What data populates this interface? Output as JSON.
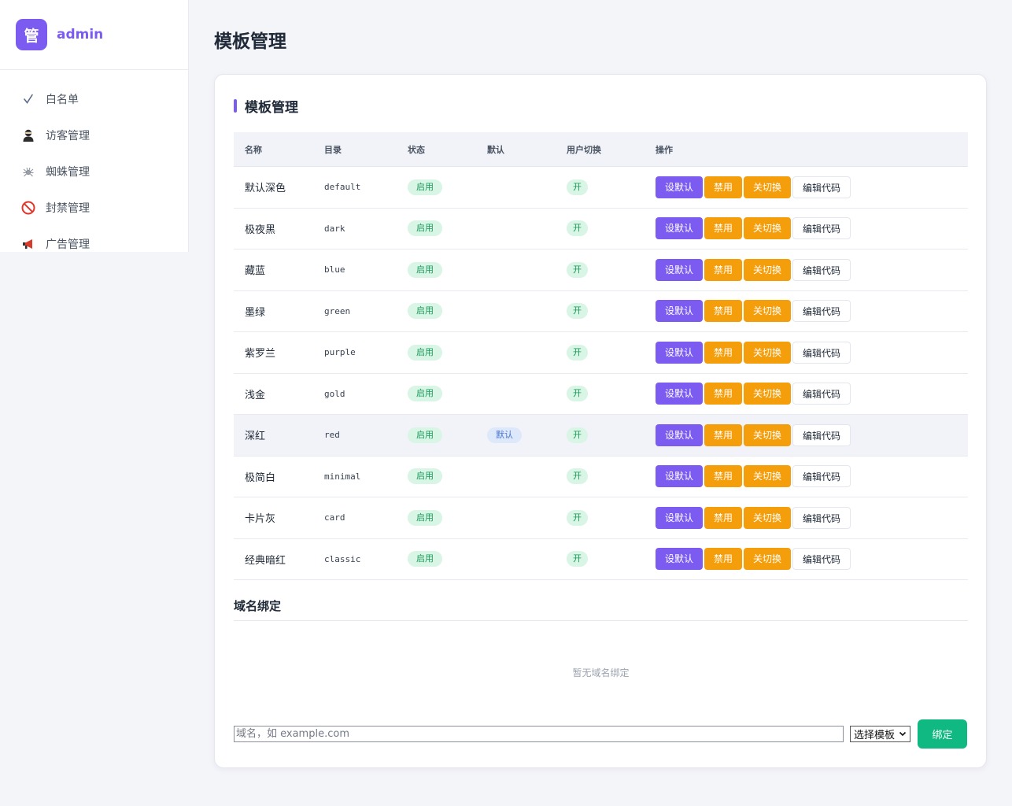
{
  "brand": {
    "logo_char": "管",
    "name": "admin",
    "accent": "#7c5cf0"
  },
  "sidebar": {
    "items": [
      {
        "label": "白名单",
        "icon": "check-icon"
      },
      {
        "label": "访客管理",
        "icon": "visitor-icon"
      },
      {
        "label": "蜘蛛管理",
        "icon": "spider-icon"
      },
      {
        "label": "封禁管理",
        "icon": "ban-icon"
      },
      {
        "label": "广告管理",
        "icon": "megaphone-icon"
      }
    ]
  },
  "page": {
    "title": "模板管理"
  },
  "templates_card": {
    "title": "模板管理",
    "columns": [
      "名称",
      "目录",
      "状态",
      "默认",
      "用户切换",
      "操作"
    ],
    "actions": {
      "set_default": "设默认",
      "disable": "禁用",
      "switch_off": "关切换",
      "edit_code": "编辑代码"
    },
    "rows": [
      {
        "name": "默认深色",
        "dir": "default",
        "status": "启用",
        "default": "",
        "switch": "开"
      },
      {
        "name": "极夜黑",
        "dir": "dark",
        "status": "启用",
        "default": "",
        "switch": "开"
      },
      {
        "name": "藏蓝",
        "dir": "blue",
        "status": "启用",
        "default": "",
        "switch": "开"
      },
      {
        "name": "墨绿",
        "dir": "green",
        "status": "启用",
        "default": "",
        "switch": "开"
      },
      {
        "name": "紫罗兰",
        "dir": "purple",
        "status": "启用",
        "default": "",
        "switch": "开"
      },
      {
        "name": "浅金",
        "dir": "gold",
        "status": "启用",
        "default": "",
        "switch": "开"
      },
      {
        "name": "深红",
        "dir": "red",
        "status": "启用",
        "default": "默认",
        "switch": "开"
      },
      {
        "name": "极简白",
        "dir": "minimal",
        "status": "启用",
        "default": "",
        "switch": "开"
      },
      {
        "name": "卡片灰",
        "dir": "card",
        "status": "启用",
        "default": "",
        "switch": "开"
      },
      {
        "name": "经典暗红",
        "dir": "classic",
        "status": "启用",
        "default": "",
        "switch": "开"
      }
    ]
  },
  "domain_binding": {
    "title": "域名绑定",
    "empty_text": "暂无域名绑定",
    "input_placeholder": "域名，如 example.com",
    "select_value": "选择模板",
    "bind_label": "绑定"
  },
  "colors": {
    "purple": "#7c5cf0",
    "orange": "#f59e0b",
    "green": "#10b981",
    "pill_green_bg": "#d8f5e6",
    "pill_blue_bg": "#dde8fb"
  }
}
